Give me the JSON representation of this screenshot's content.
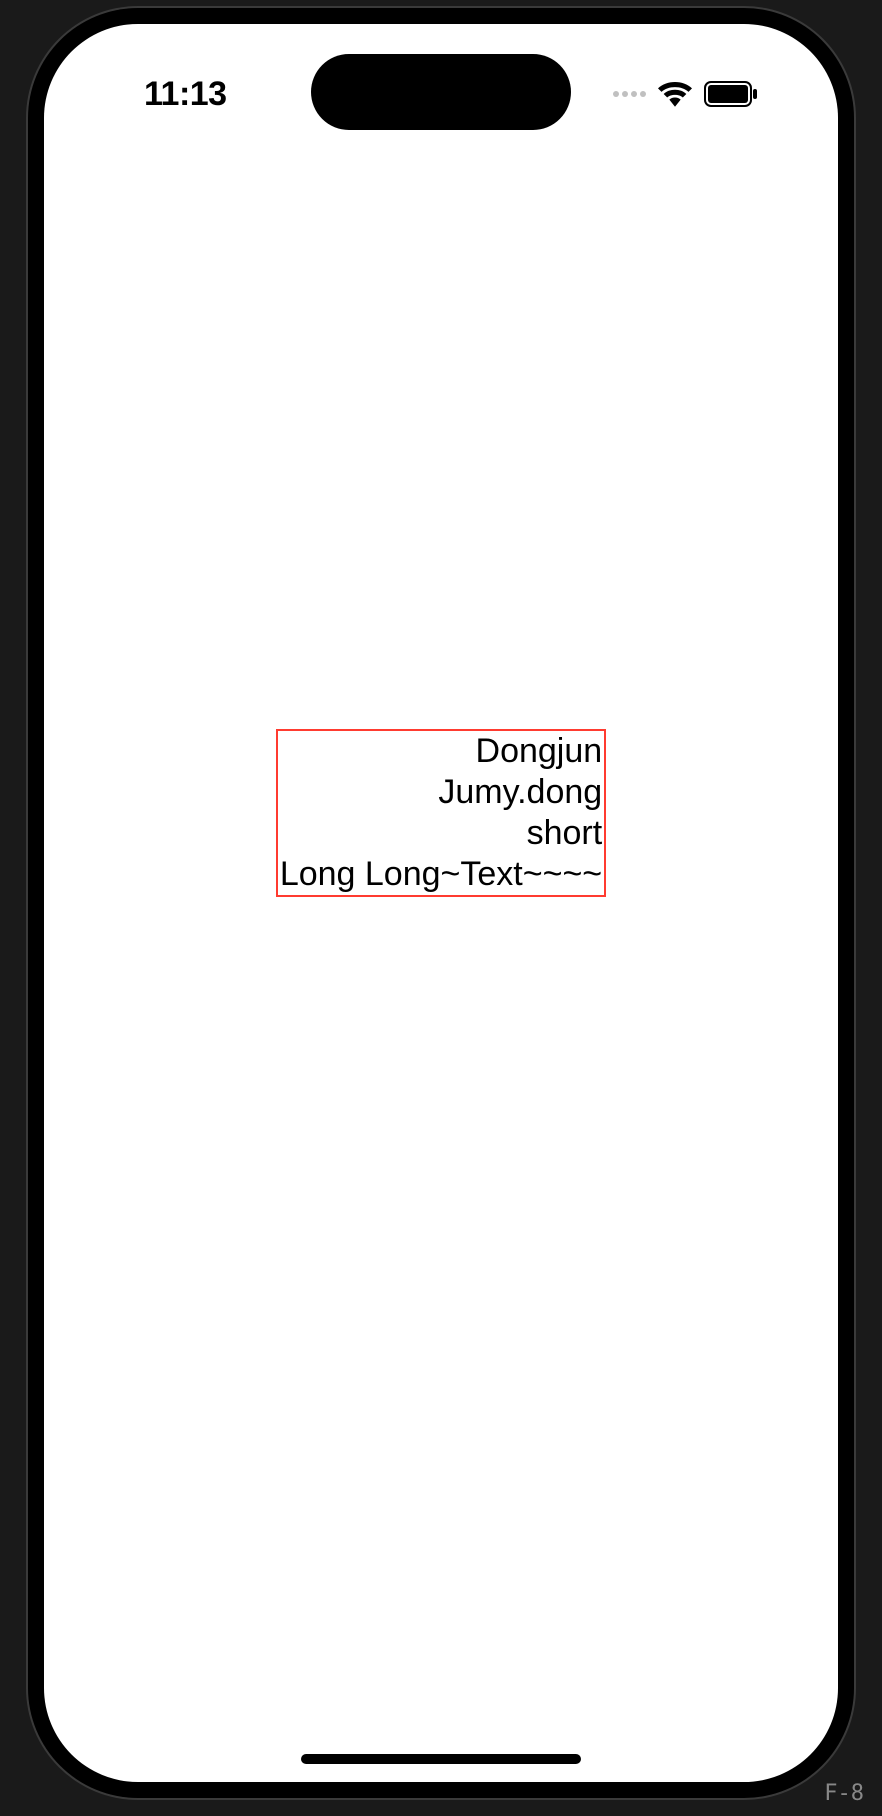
{
  "status_bar": {
    "time": "11:13"
  },
  "content": {
    "lines": [
      "Dongjun",
      "Jumy.dong",
      "short",
      "Long Long~Text~~~~"
    ]
  },
  "footer": {
    "encoding": "F-8"
  }
}
